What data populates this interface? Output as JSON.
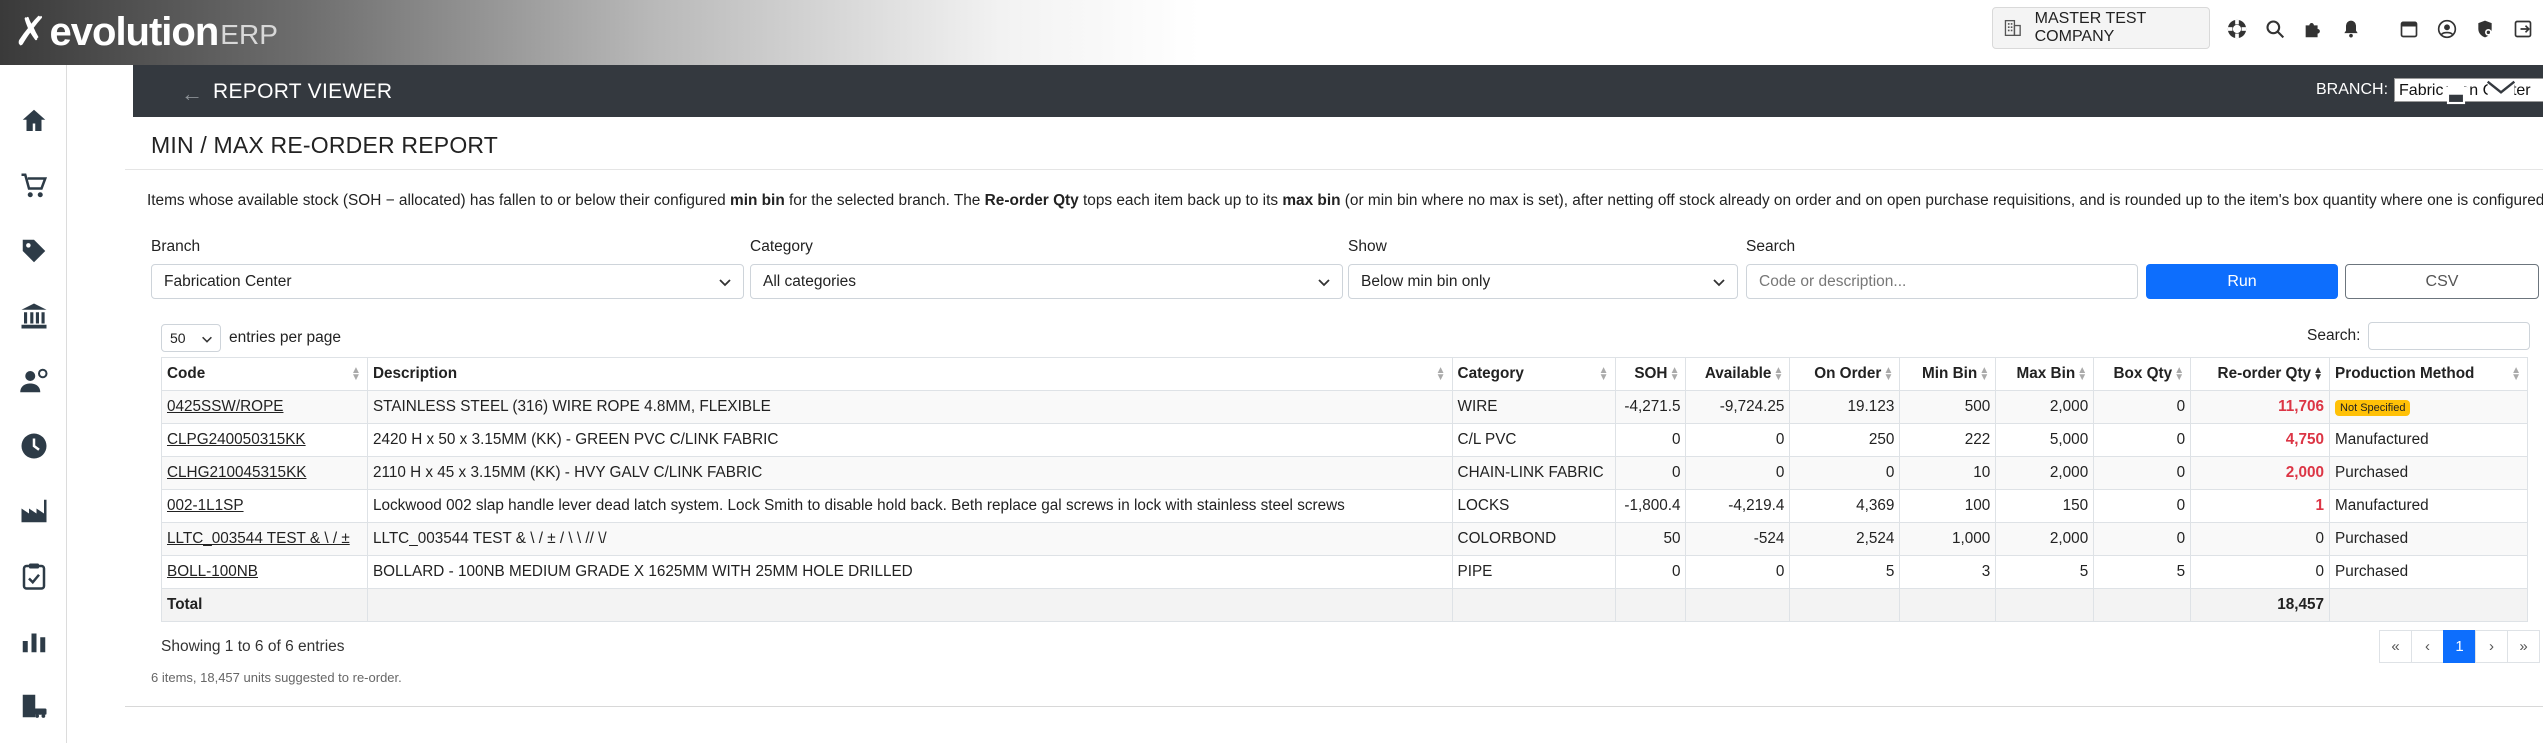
{
  "app": {
    "logo_text": "evolution",
    "logo_suffix": "ERP",
    "company": "MASTER TEST COMPANY"
  },
  "header": {
    "back_icon": "arrow-left-icon",
    "title": "REPORT VIEWER",
    "branch_label": "BRANCH:",
    "branch_value": "Fabrication Center"
  },
  "page": {
    "title": "MIN / MAX RE-ORDER REPORT",
    "info_1": "Items whose available stock (SOH − allocated) has fallen to or below their configured ",
    "info_b1": "min bin",
    "info_2": " for the selected branch. The ",
    "info_b2": "Re-order Qty",
    "info_3": " tops each item back up to its ",
    "info_b3": "max bin",
    "info_4": " (or min bin where no max is set), after netting off stock already on order and on open purchase requisitions, and is rounded up to the item's box quantity where one is configured."
  },
  "filters": {
    "branch_label": "Branch",
    "branch_value": "Fabrication Center",
    "category_label": "Category",
    "category_value": "All categories",
    "show_label": "Show",
    "show_value": "Below min bin only",
    "search_label": "Search",
    "search_placeholder": "Code or description...",
    "run_label": "Run",
    "csv_label": "CSV"
  },
  "table_controls": {
    "per_page": "50",
    "entries_label": "entries per page",
    "search_label": "Search:"
  },
  "table": {
    "columns": [
      "Code",
      "Description",
      "Category",
      "SOH",
      "Available",
      "On Order",
      "Min Bin",
      "Max Bin",
      "Box Qty",
      "Re-order Qty",
      "Production Method"
    ],
    "rows": [
      {
        "code": "0425SSW/ROPE",
        "description": "STAINLESS STEEL (316) WIRE ROPE 4.8MM, FLEXIBLE",
        "category": "WIRE",
        "soh": "-4,271.5",
        "available": "-9,724.25",
        "on_order": "19.123",
        "min_bin": "500",
        "max_bin": "2,000",
        "box_qty": "0",
        "reorder": "11,706",
        "method": "Not Specified",
        "method_badge": true
      },
      {
        "code": "CLPG240050315KK",
        "description": "2420 H x 50 x 3.15MM (KK) - GREEN PVC C/LINK FABRIC",
        "category": "C/L PVC",
        "soh": "0",
        "available": "0",
        "on_order": "250",
        "min_bin": "222",
        "max_bin": "5,000",
        "box_qty": "0",
        "reorder": "4,750",
        "method": "Manufactured",
        "method_badge": false
      },
      {
        "code": "CLHG210045315KK",
        "description": "2110 H x 45 x 3.15MM (KK) - HVY GALV C/LINK FABRIC",
        "category": "CHAIN-LINK FABRIC",
        "soh": "0",
        "available": "0",
        "on_order": "0",
        "min_bin": "10",
        "max_bin": "2,000",
        "box_qty": "0",
        "reorder": "2,000",
        "method": "Purchased",
        "method_badge": false
      },
      {
        "code": "002-1L1SP",
        "description": "Lockwood 002 slap handle lever dead latch system. Lock Smith to disable hold back. Beth replace gal screws in lock with stainless steel screws",
        "category": "LOCKS",
        "soh": "-1,800.4",
        "available": "-4,219.4",
        "on_order": "4,369",
        "min_bin": "100",
        "max_bin": "150",
        "box_qty": "0",
        "reorder": "1",
        "method": "Manufactured",
        "method_badge": false
      },
      {
        "code": "LLTC_003544 TEST & \\ / ±",
        "description": "LLTC_003544 TEST & \\ / ± / \\ \\ // \\/",
        "category": "COLORBOND",
        "soh": "50",
        "available": "-524",
        "on_order": "2,524",
        "min_bin": "1,000",
        "max_bin": "2,000",
        "box_qty": "0",
        "reorder": "0",
        "method": "Purchased",
        "method_badge": false
      },
      {
        "code": "BOLL-100NB",
        "description": "BOLLARD - 100NB MEDIUM GRADE X 1625MM WITH 25MM HOLE DRILLED",
        "category": "PIPE",
        "soh": "0",
        "available": "0",
        "on_order": "5",
        "min_bin": "3",
        "max_bin": "5",
        "box_qty": "5",
        "reorder": "0",
        "method": "Purchased",
        "method_badge": false
      }
    ],
    "total_label": "Total",
    "total_reorder": "18,457"
  },
  "footer": {
    "showing": "Showing 1 to 6 of 6 entries",
    "summary": "6 items, 18,457 units suggested to re-order.",
    "pages": [
      "«",
      "‹",
      "1",
      "›",
      "»"
    ],
    "active_page": "1"
  },
  "colors": {
    "accent": "#0d6efd",
    "header_bg": "#34393f",
    "reorder_red": "#dc3545",
    "badge_yellow": "#ffc107"
  }
}
